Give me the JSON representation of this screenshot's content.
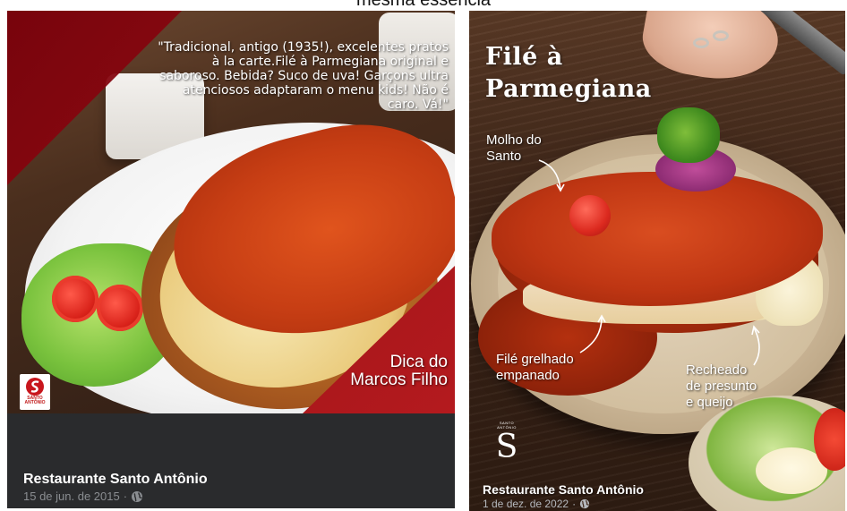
{
  "top_caption": "mesma essência",
  "left_post": {
    "quote": "\"Tradicional, antigo (1935!), excelentes pratos à la carte.Filé à Parmegiana original e saboroso. Bebida? Suco de uva! Garçons ultra atenciosos adaptaram o menu kids! Não é caro. Vá!\"",
    "tip_line1": "Dica do",
    "tip_line2": "Marcos Filho",
    "logo_text": "SANTO ANTÔNIO",
    "page_name": "Restaurante Santo Antônio",
    "date": "15 de jun. de 2015",
    "separator": "·",
    "privacy_icon": "globe-icon"
  },
  "right_post": {
    "title_line1": "Filé à",
    "title_line2": "Parmegiana",
    "annotation_sauce_line1": "Molho do",
    "annotation_sauce_line2": "Santo",
    "annotation_fillet_line1": "Filé grelhado",
    "annotation_fillet_line2": "empanado",
    "annotation_filling_line1": "Recheado",
    "annotation_filling_line2": "de presunto",
    "annotation_filling_line3": "e queijo",
    "logo_small": "SANTO ANTÔNIO",
    "logo_letter": "S",
    "page_name": "Restaurante Santo Antônio",
    "date": "1 de dez. de 2022",
    "separator": "·",
    "privacy_icon": "globe-icon"
  },
  "colors": {
    "brand_red": "#b41a1e",
    "card_dark": "#2a2b2d",
    "meta_gray": "#8a8d91"
  }
}
